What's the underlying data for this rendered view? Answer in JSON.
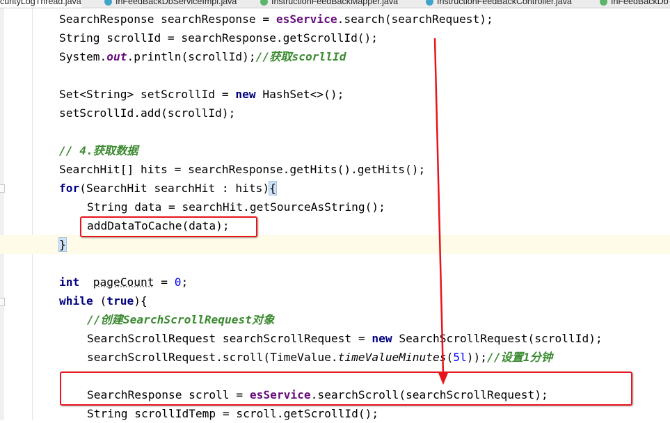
{
  "tabs": [
    {
      "label": "curityLogThread.java",
      "icon": "java-class-icon",
      "active": true
    },
    {
      "label": "InFeedBackDbServiceImpl.java",
      "icon": "java-class-icon",
      "active": false
    },
    {
      "label": "InstructionFeedBackMapper.java",
      "icon": "java-interface-icon",
      "active": false
    },
    {
      "label": "InstructionFeedBackController.java",
      "icon": "java-class-icon",
      "active": false
    },
    {
      "label": "InFeedBackDb",
      "icon": "java-interface-icon",
      "active": false
    }
  ],
  "code": {
    "l1": {
      "a": "SearchResponse searchResponse = ",
      "f": "esService",
      "b": ".search(searchRequest);"
    },
    "l2": {
      "a": "String scrollId = searchResponse.getScrollId();"
    },
    "l3": {
      "a": "System.",
      "f": "out",
      "b": ".println(scrollId);",
      "c": "//获取scorllId"
    },
    "l4": {
      "a": "Set<String> setScrollId = ",
      "k": "new",
      "b": " HashSet<>();"
    },
    "l5": {
      "a": "setScrollId.add(scrollId);"
    },
    "l6": {
      "c": "// 4.获取数据"
    },
    "l7": {
      "a": "SearchHit[] hits = searchResponse.getHits().getHits();"
    },
    "l8": {
      "k": "for",
      "a": "(SearchHit searchHit : hits)",
      "b": "{"
    },
    "l9": {
      "a": "String data = searchHit.getSourceAsString();"
    },
    "l10": {
      "a": "addDataToCache(data);"
    },
    "l11": {
      "b": "}"
    },
    "l12": {
      "k": "int",
      "a": "  ",
      "v": "pageCount",
      "b": " = ",
      "n": "0",
      "e": ";"
    },
    "l13": {
      "k": "while",
      "a": " (",
      "k2": "true",
      "b": "){"
    },
    "l14": {
      "c": "//创建SearchScrollRequest对象"
    },
    "l15": {
      "a": "SearchScrollRequest searchScrollRequest = ",
      "k": "new",
      "b": " SearchScrollRequest(scrollId);"
    },
    "l16": {
      "a": "searchScrollRequest.scroll(TimeValue.",
      "m": "timeValueMinutes",
      "b": "(",
      "n": "5l",
      "e": "));",
      "c": "//设置1分钟"
    },
    "l17": {
      "a": "SearchResponse scroll = ",
      "f": "esService",
      "b": ".searchScroll(searchScrollRequest);"
    },
    "l18": {
      "a": "String scrollIdTemp = scroll.getScrollId();"
    }
  },
  "colors": {
    "annotation": "#e8141b",
    "keyword": "#000080",
    "field": "#660e7a",
    "comment": "#3a8a2f",
    "number": "#0000ff"
  }
}
